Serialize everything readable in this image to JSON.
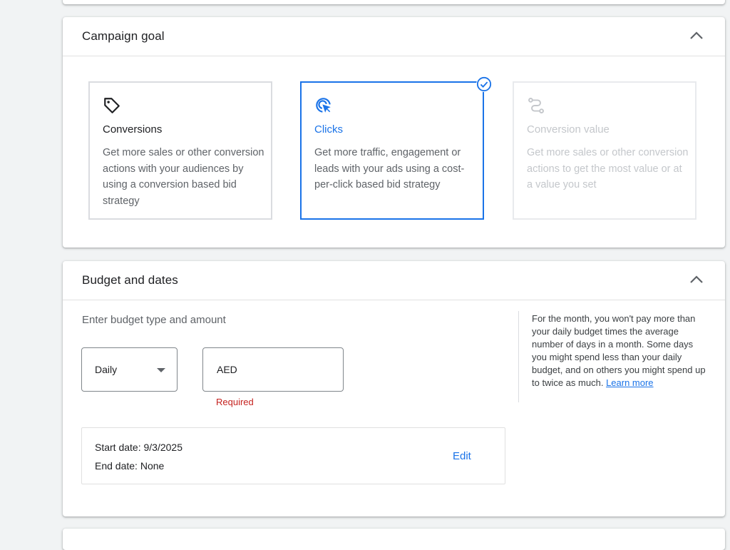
{
  "campaign_goal": {
    "title": "Campaign goal",
    "options": [
      {
        "title": "Conversions",
        "description": "Get more sales or other conversion actions with your audiences by using a conversion based bid strategy",
        "icon": "tag-icon",
        "state": "default"
      },
      {
        "title": "Clicks",
        "description": "Get more traffic, engagement or leads with your ads using a cost-per-click based bid strategy",
        "icon": "cursor-click-icon",
        "state": "selected"
      },
      {
        "title": "Conversion value",
        "description": "Get more sales or other conversion actions to get the most value or at a value you set",
        "icon": "route-icon",
        "state": "disabled"
      }
    ]
  },
  "budget": {
    "title": "Budget and dates",
    "label": "Enter budget type and amount",
    "budget_type": "Daily",
    "currency": "AED",
    "amount_value": "",
    "error": "Required",
    "start_date": "Start date: 9/3/2025",
    "end_date": "End date: None",
    "edit_label": "Edit",
    "help_text": "For the month, you won't pay more than your daily budget times the average number of days in a month. Some days you might spend less than your daily budget, and on others you might spend up to twice as much.",
    "learn_more": "Learn more"
  },
  "colors": {
    "accent": "#1a73e8",
    "error": "#c5221f",
    "disabled_text": "#c4c7cb"
  }
}
